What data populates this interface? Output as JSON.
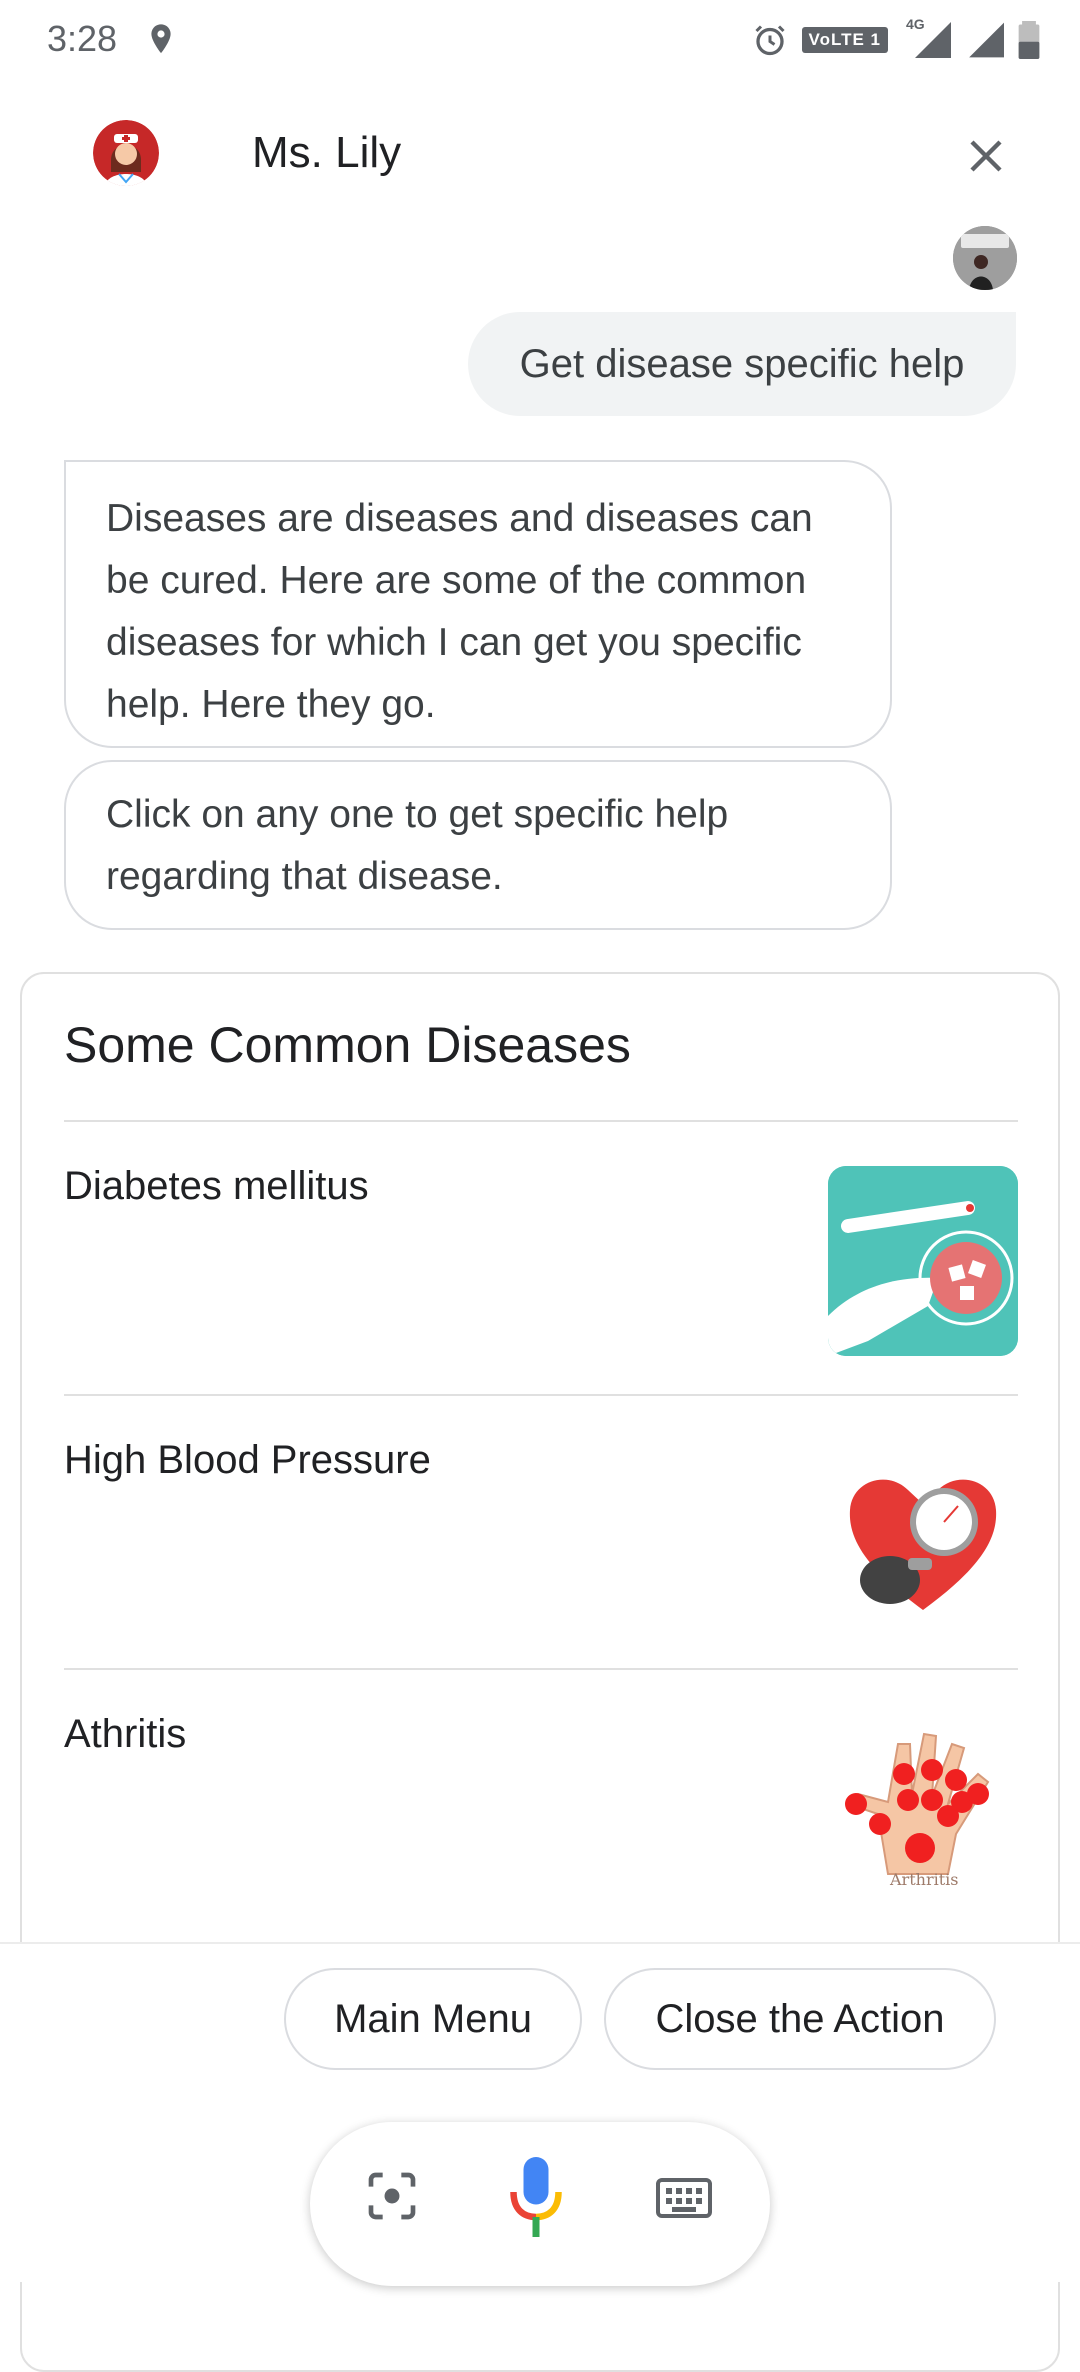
{
  "status_bar": {
    "time": "3:28",
    "network_badge": "VoLTE 1",
    "network_type": "4G"
  },
  "header": {
    "bot_name": "Ms. Lily"
  },
  "conversation": {
    "user_message": "Get disease specific help",
    "bot_messages": [
      "Diseases are diseases and diseases can be cured. Here are some of the common diseases for which I can get you specific help. Here they go.",
      "Click on any one to get specific help regarding that disease."
    ]
  },
  "card": {
    "title": "Some Common Diseases",
    "items": [
      {
        "title": "Diabetes mellitus",
        "thumb_icon": "diabetes-image"
      },
      {
        "title": "High Blood Pressure",
        "thumb_icon": "heart-bp-image"
      },
      {
        "title": "Athritis",
        "thumb_icon": "arthritis-image",
        "thumb_caption": "Arthritis"
      }
    ]
  },
  "suggestions": {
    "chip_1": "Main Menu",
    "chip_2": "Close the Action"
  },
  "colors": {
    "accent_teal": "#4fc3b8",
    "heart_red": "#e53935",
    "google_blue": "#4285f4"
  }
}
